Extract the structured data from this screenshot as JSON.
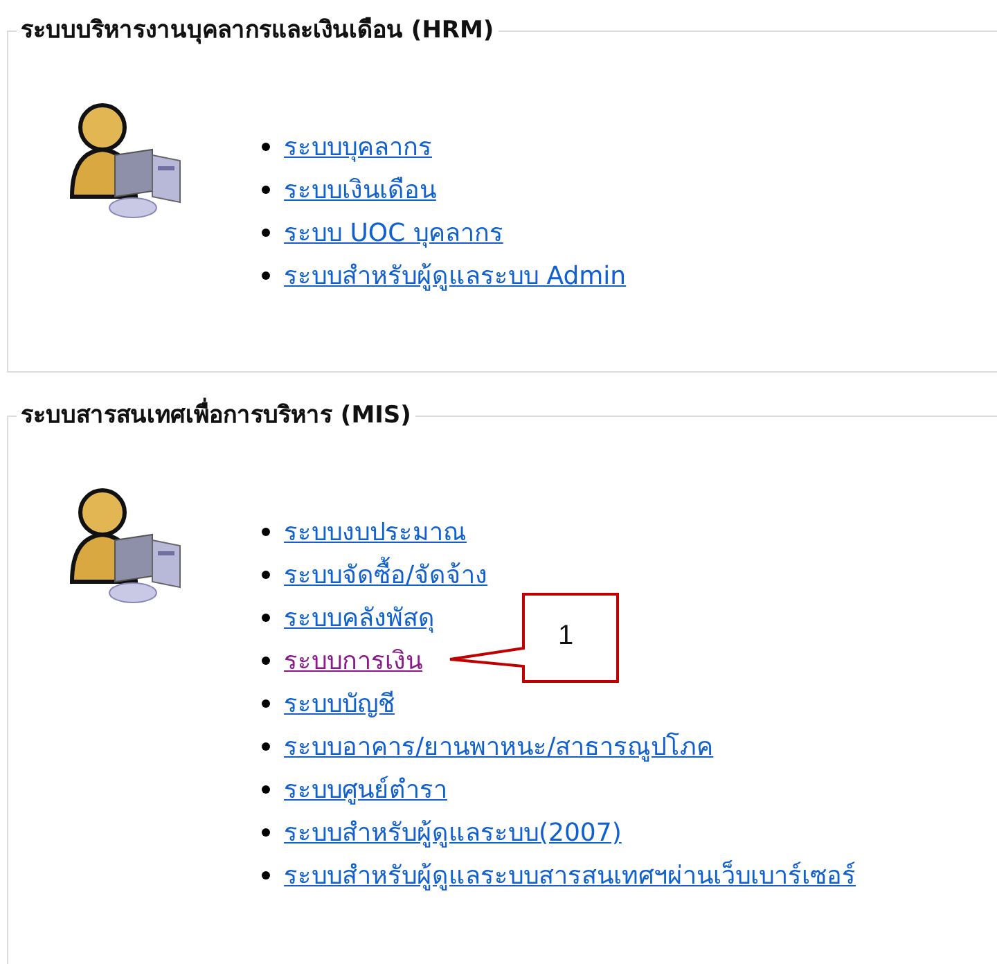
{
  "sections": [
    {
      "title": "ระบบบริหารงานบุคลากรและเงินเดือน (HRM)",
      "links": [
        {
          "label": "ระบบบุคลากร",
          "visited": false
        },
        {
          "label": "ระบบเงินเดือน",
          "visited": false
        },
        {
          "label": "ระบบ UOC บุคลากร",
          "visited": false
        },
        {
          "label": "ระบบสำหรับผู้ดูแลระบบ Admin",
          "visited": false
        }
      ]
    },
    {
      "title": "ระบบสารสนเทศเพื่อการบริหาร (MIS)",
      "links": [
        {
          "label": "ระบบงบประมาณ",
          "visited": false
        },
        {
          "label": "ระบบจัดซื้อ/จัดจ้าง",
          "visited": false
        },
        {
          "label": "ระบบคลังพัสดุ",
          "visited": false
        },
        {
          "label": "ระบบการเงิน",
          "visited": true,
          "callout": "1"
        },
        {
          "label": "ระบบบัญชี",
          "visited": false
        },
        {
          "label": "ระบบอาคาร/ยานพาหนะ/สาธารณูปโภค",
          "visited": false
        },
        {
          "label": "ระบบศูนย์ตำรา",
          "visited": false
        },
        {
          "label": "ระบบสำหรับผู้ดูแลระบบ(2007)",
          "visited": false
        },
        {
          "label": "ระบบสำหรับผู้ดูแลระบบสารสนเทศฯผ่านเว็บเบาร์เซอร์",
          "visited": false
        }
      ]
    }
  ]
}
